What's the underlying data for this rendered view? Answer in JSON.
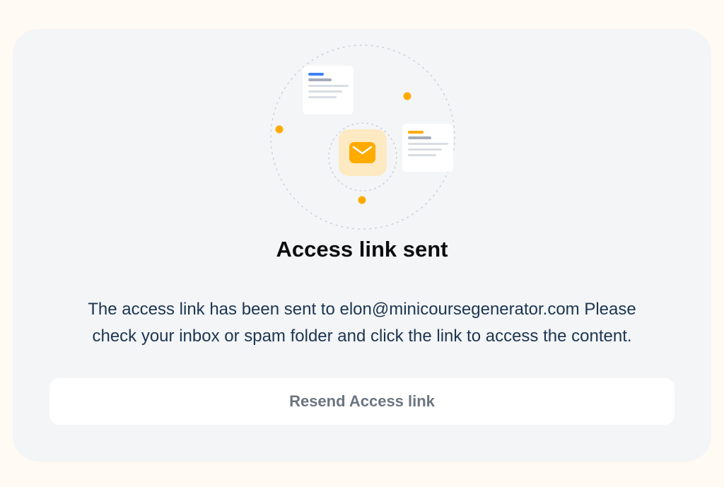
{
  "dialog": {
    "title": "Access link sent",
    "message_line1": "The access link has been sent to elon@minicoursegenerator.com Please",
    "message_line2": "check your inbox or spam folder and click the link to access the content.",
    "resend_label": "Resend Access link"
  },
  "colors": {
    "page_background": "#fffaf3",
    "card_background": "#f3f5f7",
    "accent_orange": "#ffab00",
    "accent_blue": "#3b82f6",
    "text_dark": "#0d0d0d",
    "text_body": "#1d3550",
    "button_text": "#6b7580"
  },
  "icons": {
    "center": "mail-envelope-icon",
    "documents": "document-card-icon"
  }
}
